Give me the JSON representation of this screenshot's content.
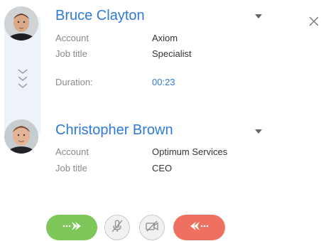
{
  "call": {
    "caller": {
      "name": "Bruce Clayton",
      "fields": {
        "account_label": "Account",
        "account_value": "Axiom",
        "jobtitle_label": "Job title",
        "jobtitle_value": "Specialist",
        "duration_label": "Duration:",
        "duration_value": "00:23"
      }
    },
    "transfer_target": {
      "name": "Christopher Brown",
      "fields": {
        "account_label": "Account",
        "account_value": "Optimum Services",
        "jobtitle_label": "Job title",
        "jobtitle_value": "CEO"
      }
    }
  },
  "controls": {
    "transfer_icon": "transfer-arrow-icon",
    "mute_icon": "microphone-off-icon",
    "video_icon": "video-off-icon",
    "hangup_icon": "hangup-arrow-icon",
    "close_icon": "close-icon"
  },
  "colors": {
    "name_blue": "#2f7ad6",
    "transfer_green": "#7cc65a",
    "hangup_red": "#ef7060",
    "timeline_bg": "#eef3fa"
  }
}
